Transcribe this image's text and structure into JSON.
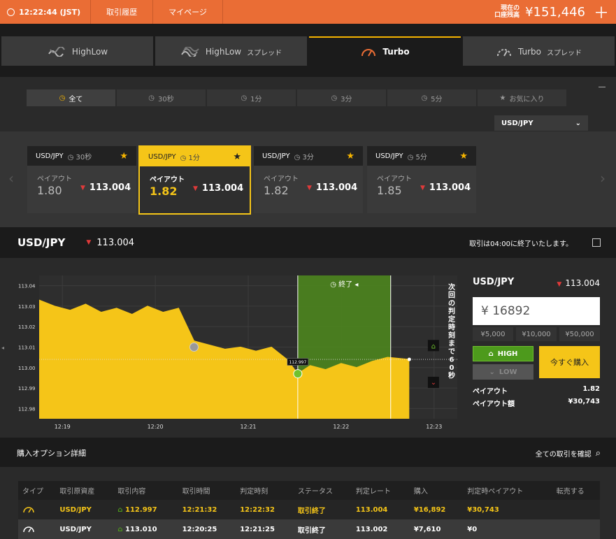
{
  "topbar": {
    "time": "12:22:44 (JST)",
    "nav": [
      "取引履歴",
      "マイページ"
    ],
    "balance_label_1": "現在の",
    "balance_label_2": "口座残高",
    "balance": "¥151,446",
    "add_icon": "plus-icon"
  },
  "product_tabs": [
    {
      "label": "HighLow",
      "sub": "",
      "icon": "highlow-icon",
      "active": false
    },
    {
      "label": "HighLow",
      "sub": "スプレッド",
      "icon": "highlow-spread-icon",
      "active": false
    },
    {
      "label": "Turbo",
      "sub": "",
      "icon": "turbo-gauge-icon",
      "active": true
    },
    {
      "label": "Turbo",
      "sub": "スプレッド",
      "icon": "turbo-spread-icon",
      "active": false
    }
  ],
  "filters": [
    {
      "label": "全て",
      "icon": "clock-icon",
      "active": true
    },
    {
      "label": "30秒",
      "icon": "clock-icon",
      "active": false
    },
    {
      "label": "1分",
      "icon": "clock-icon",
      "active": false
    },
    {
      "label": "3分",
      "icon": "clock-icon",
      "active": false
    },
    {
      "label": "5分",
      "icon": "clock-icon",
      "active": false
    },
    {
      "label": "お気に入り",
      "icon": "star-icon",
      "active": false
    }
  ],
  "pair_select": "USD/JPY",
  "cards": [
    {
      "pair": "USD/JPY",
      "duration": "30秒",
      "payout_label": "ペイアウト",
      "payout": "1.80",
      "rate": "113.004",
      "selected": false
    },
    {
      "pair": "USD/JPY",
      "duration": "1分",
      "payout_label": "ペイアウト",
      "payout": "1.82",
      "rate": "113.004",
      "selected": true
    },
    {
      "pair": "USD/JPY",
      "duration": "3分",
      "payout_label": "ペイアウト",
      "payout": "1.82",
      "rate": "113.004",
      "selected": false
    },
    {
      "pair": "USD/JPY",
      "duration": "5分",
      "payout_label": "ペイアウト",
      "payout": "1.85",
      "rate": "113.004",
      "selected": false
    }
  ],
  "asset": {
    "pair": "USD/JPY",
    "rate": "113.004",
    "notice": "取引は04:00に終了いたします。"
  },
  "chart": {
    "end_label": "終了",
    "countdown": "次回の判定時刻まで60秒",
    "entry_marker": "112.997",
    "y_ticks": [
      "113.04",
      "113.03",
      "113.02",
      "113.01",
      "113.00",
      "112.99",
      "112.98"
    ],
    "x_ticks": [
      "12:19",
      "12:20",
      "12:21",
      "12:22",
      "12:23"
    ]
  },
  "chart_data": {
    "type": "area",
    "title": "",
    "xlabel": "",
    "ylabel": "",
    "ylim": [
      112.975,
      113.045
    ],
    "xlim": [
      "12:18:45",
      "12:23:15"
    ],
    "x": [
      "12:18:45",
      "12:18:55",
      "12:19:05",
      "12:19:15",
      "12:19:25",
      "12:19:35",
      "12:19:45",
      "12:19:55",
      "12:20:05",
      "12:20:15",
      "12:20:25",
      "12:20:35",
      "12:20:45",
      "12:20:55",
      "12:21:05",
      "12:21:15",
      "12:21:25",
      "12:21:32",
      "12:21:40",
      "12:21:50",
      "12:22:00",
      "12:22:10",
      "12:22:20",
      "12:22:30",
      "12:22:44"
    ],
    "series": [
      {
        "values": [
          113.033,
          113.03,
          113.028,
          113.031,
          113.027,
          113.029,
          113.026,
          113.03,
          113.027,
          113.029,
          113.013,
          113.011,
          113.009,
          113.01,
          113.008,
          113.01,
          113.004,
          112.997,
          113.001,
          112.999,
          113.002,
          113.0,
          113.003,
          113.005,
          113.004
        ]
      }
    ],
    "current_rate": 113.004,
    "entry_rate": 112.997,
    "entry_time": "12:21:32",
    "expiry_time": "12:22:32"
  },
  "order": {
    "pair": "USD/JPY",
    "rate": "113.004",
    "amount": "¥ 16892",
    "presets": [
      "¥5,000",
      "¥10,000",
      "¥50,000"
    ],
    "high_label": "HIGH",
    "low_label": "LOW",
    "buy_label": "今すぐ購入",
    "payout_label": "ペイアウト",
    "payout": "1.82",
    "payout_amount_label": "ペイアウト額",
    "payout_amount": "¥30,743"
  },
  "details": {
    "title": "購入オプション詳細",
    "link": "全ての取引を確認",
    "columns": [
      "タイプ",
      "取引原資産",
      "取引内容",
      "取引時間",
      "判定時刻",
      "ステータス",
      "判定レート",
      "購入",
      "判定時ペイアウト",
      "転売する"
    ],
    "rows": [
      [
        "",
        "USD/JPY",
        "112.997",
        "12:21:32",
        "12:22:32",
        "取引終了",
        "113.004",
        "¥16,892",
        "¥30,743",
        ""
      ],
      [
        "",
        "USD/JPY",
        "113.010",
        "12:20:25",
        "12:21:25",
        "取引終了",
        "113.002",
        "¥7,610",
        "¥0",
        ""
      ]
    ]
  },
  "colors": {
    "accent": "#ea6d35",
    "yellow": "#f5c518",
    "green": "#4d9a1c",
    "red": "#e03a3a"
  }
}
